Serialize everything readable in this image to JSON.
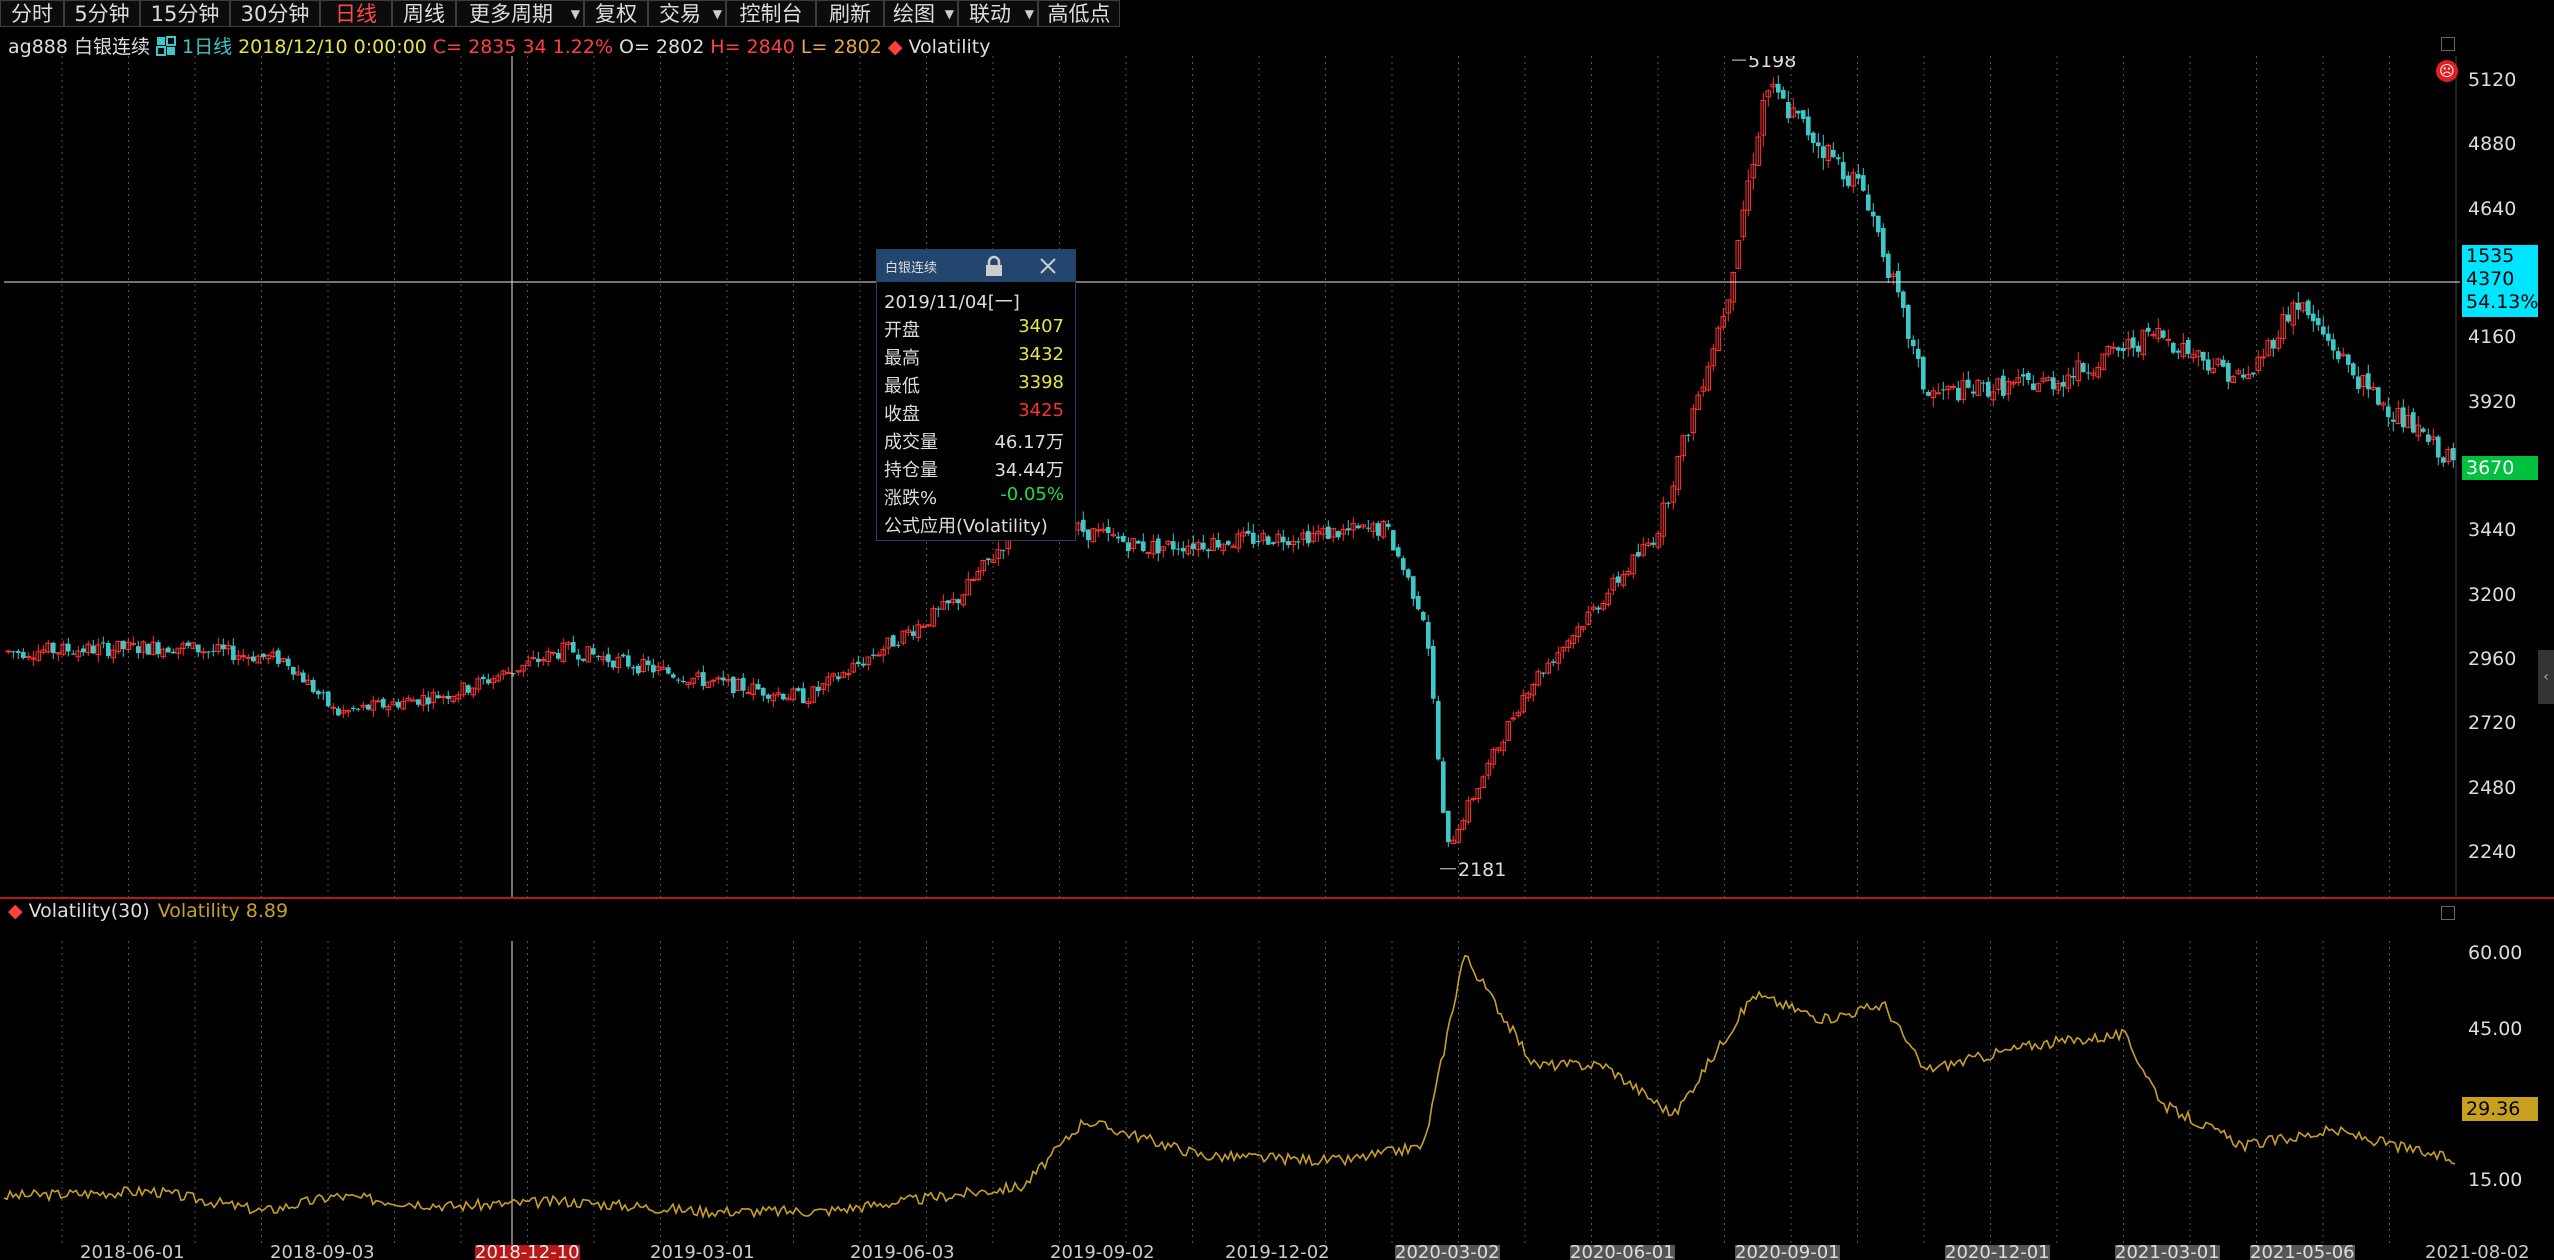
{
  "toolbar": {
    "buttons": [
      {
        "label": "分时"
      },
      {
        "label": "5分钟"
      },
      {
        "label": "15分钟"
      },
      {
        "label": "30分钟"
      },
      {
        "label": "日线"
      },
      {
        "label": "周线"
      },
      {
        "label": "更多周期"
      },
      {
        "label": "复权"
      },
      {
        "label": "交易"
      },
      {
        "label": "控制台"
      },
      {
        "label": "刷新"
      },
      {
        "label": "绘图"
      },
      {
        "label": "联动"
      },
      {
        "label": "高低点"
      }
    ]
  },
  "info": {
    "code": "ag888",
    "name": "白银连续",
    "period": "1日线",
    "datetime": "2018/12/10 0:00:00",
    "close": "C= 2835",
    "change": "34",
    "change_pct": "1.22%",
    "open": "O= 2802",
    "high": "H= 2840",
    "low": "L= 2802",
    "indicator": "Volatility"
  },
  "price_axis": [
    "5120",
    "4880",
    "4640",
    "4160",
    "3920",
    "3440",
    "3200",
    "2960",
    "2720",
    "2480",
    "2240"
  ],
  "crosshair_tag": {
    "line1": "1535",
    "line2": "4370",
    "line3": "54.13%"
  },
  "last_price_tag": "3670",
  "extremes": {
    "high": "5198",
    "low": "2181"
  },
  "volatility": {
    "title": "Volatility(30)",
    "value_label": "Volatility 8.89",
    "axis": [
      "60.00",
      "45.00",
      "15.00"
    ],
    "current_tag": "29.36"
  },
  "date_axis": [
    "2018-06-01",
    "2018-09-03",
    "2018-12-10",
    "2019-03-01",
    "2019-06-03",
    "2019-09-02",
    "2019-12-02",
    "2020-03-02",
    "2020-06-01",
    "2020-09-01",
    "2020-12-01",
    "2021-03-01",
    "2021-05-06",
    "2021-08-02"
  ],
  "tooltip": {
    "title": "白银连续",
    "date": "2019/11/04[一]",
    "rows": [
      {
        "key": "开盘",
        "value": "3407"
      },
      {
        "key": "最高",
        "value": "3432"
      },
      {
        "key": "最低",
        "value": "3398"
      },
      {
        "key": "收盘",
        "value": "3425"
      },
      {
        "key": "成交量",
        "value": "46.17万"
      },
      {
        "key": "持仓量",
        "value": "34.44万"
      },
      {
        "key": "涨跌%",
        "value": "-0.05%"
      }
    ],
    "formula": "公式应用(Volatility)"
  },
  "colors": {
    "up": "#ff3232",
    "down": "#3cc8c8",
    "volatility": "#c8a028",
    "crosshair_tag": "#00e5ff",
    "last_tag": "#00c040",
    "vol_tag": "#c8a020"
  },
  "chart_data": [
    {
      "type": "candlestick",
      "title": "",
      "y_ticks": [
        2240,
        2480,
        2720,
        2960,
        3200,
        3440,
        3920,
        4160,
        4640,
        4880,
        5120
      ],
      "x_ticks": [
        "2018-06-01",
        "2018-09-03",
        "2018-12-10",
        "2019-03-01",
        "2019-06-03",
        "2019-09-02",
        "2019-12-02",
        "2020-03-02",
        "2020-06-01",
        "2020-09-01",
        "2020-12-01",
        "2021-03-01",
        "2021-05-06",
        "2021-08-02"
      ],
      "series": [
        {
          "x": [
            "2018-04",
            "2018-06",
            "2018-08",
            "2018-10",
            "2018-12",
            "2019-02",
            "2019-04",
            "2019-06",
            "2019-08",
            "2019-09",
            "2019-11",
            "2020-01",
            "2020-03",
            "2020-03b",
            "2020-04",
            "2020-06",
            "2020-07",
            "2020-08",
            "2020-09",
            "2020-11",
            "2020-12",
            "2021-02",
            "2021-03",
            "2021-05",
            "2021-06",
            "2021-08"
          ],
          "values": [
            2990,
            3010,
            2960,
            2760,
            2840,
            3000,
            2880,
            2820,
            3180,
            3500,
            3380,
            3450,
            3100,
            2250,
            2850,
            3430,
            4300,
            5100,
            4700,
            3950,
            4000,
            4180,
            4000,
            4300,
            3970,
            3680
          ]
        }
      ],
      "annotations": [
        "5198",
        "2181"
      ]
    },
    {
      "type": "line",
      "title": "Volatility(30)",
      "y_ticks": [
        15,
        45,
        60
      ],
      "series": [
        {
          "x": [
            "2018-04",
            "2018-06",
            "2018-08",
            "2018-10",
            "2018-12",
            "2019-02",
            "2019-04",
            "2019-06",
            "2019-08",
            "2019-09",
            "2019-11",
            "2020-01",
            "2020-03",
            "2020-04",
            "2020-05",
            "2020-06",
            "2020-08",
            "2020-09",
            "2020-10",
            "2020-11",
            "2020-12",
            "2021-02",
            "2021-03",
            "2021-04",
            "2021-05",
            "2021-06",
            "2021-08"
          ],
          "values": [
            12,
            13,
            9,
            12,
            10,
            11,
            9,
            9,
            14,
            27,
            20,
            19,
            22,
            60,
            38,
            38,
            28,
            52,
            47,
            50,
            37,
            42,
            44,
            30,
            22,
            25,
            19
          ]
        }
      ]
    }
  ]
}
